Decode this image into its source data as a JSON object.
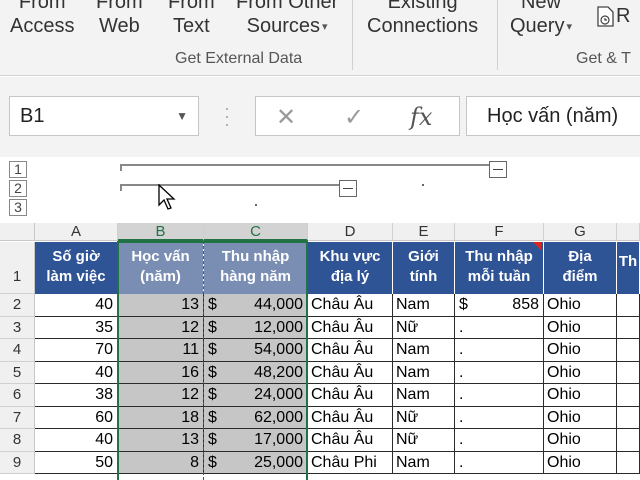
{
  "ribbon": {
    "buttons": [
      {
        "line1": "From",
        "line2": "Access"
      },
      {
        "line1": "From",
        "line2": "Web"
      },
      {
        "line1": "From",
        "line2": "Text"
      },
      {
        "line1": "From Other",
        "line2": "Sources"
      },
      {
        "line1": "Existing",
        "line2": "Connections"
      },
      {
        "line1": "New",
        "line2": "Query"
      },
      {
        "line1": "",
        "line2": "R"
      }
    ],
    "group_get_external": "Get External Data",
    "group_get_transform": "Get & T"
  },
  "namebox": {
    "value": "B1"
  },
  "formula_bar": {
    "fx": "fx",
    "cancel": "✕",
    "enter": "✓",
    "content": "Học vấn (năm)"
  },
  "outline_levels": [
    "1",
    "2",
    "3"
  ],
  "columns": [
    "A",
    "B",
    "C",
    "D",
    "E",
    "F",
    "G"
  ],
  "headers": {
    "A": [
      "Số giờ",
      "làm việc"
    ],
    "B": [
      "Học vấn",
      "(năm)"
    ],
    "C": [
      "Thu nhập",
      "hàng năm"
    ],
    "D": [
      "Khu vực",
      "địa lý"
    ],
    "E": [
      "Giới",
      "tính"
    ],
    "F": [
      "Thu nhập",
      "mỗi tuần"
    ],
    "G": [
      "Địa",
      "điểm"
    ],
    "H": [
      "Th"
    ]
  },
  "rows": [
    {
      "n": "2",
      "a": "40",
      "b": "13",
      "c_sym": "$",
      "c": "44,000",
      "d": "Châu Âu",
      "e": "Nam",
      "f_sym": "$",
      "f": "858",
      "g": "Ohio"
    },
    {
      "n": "3",
      "a": "35",
      "b": "12",
      "c_sym": "$",
      "c": "12,000",
      "d": "Châu Âu",
      "e": "Nữ",
      "f_sym": ".",
      "f": "",
      "g": "Ohio"
    },
    {
      "n": "4",
      "a": "70",
      "b": "11",
      "c_sym": "$",
      "c": "54,000",
      "d": "Châu Âu",
      "e": "Nam",
      "f_sym": ".",
      "f": "",
      "g": "Ohio"
    },
    {
      "n": "5",
      "a": "40",
      "b": "16",
      "c_sym": "$",
      "c": "48,200",
      "d": "Châu Âu",
      "e": "Nam",
      "f_sym": ".",
      "f": "",
      "g": "Ohio"
    },
    {
      "n": "6",
      "a": "38",
      "b": "12",
      "c_sym": "$",
      "c": "24,000",
      "d": "Châu Âu",
      "e": "Nam",
      "f_sym": ".",
      "f": "",
      "g": "Ohio"
    },
    {
      "n": "7",
      "a": "60",
      "b": "18",
      "c_sym": "$",
      "c": "62,000",
      "d": "Châu Âu",
      "e": "Nữ",
      "f_sym": ".",
      "f": "",
      "g": "Ohio"
    },
    {
      "n": "8",
      "a": "40",
      "b": "13",
      "c_sym": "$",
      "c": "17,000",
      "d": "Châu Âu",
      "e": "Nữ",
      "f_sym": ".",
      "f": "",
      "g": "Ohio"
    },
    {
      "n": "9",
      "a": "50",
      "b": "8",
      "c_sym": "$",
      "c": "25,000",
      "d": "Châu Phi",
      "e": "Nam",
      "f_sym": ".",
      "f": "",
      "g": "Ohio"
    }
  ],
  "header_row_number": "1"
}
